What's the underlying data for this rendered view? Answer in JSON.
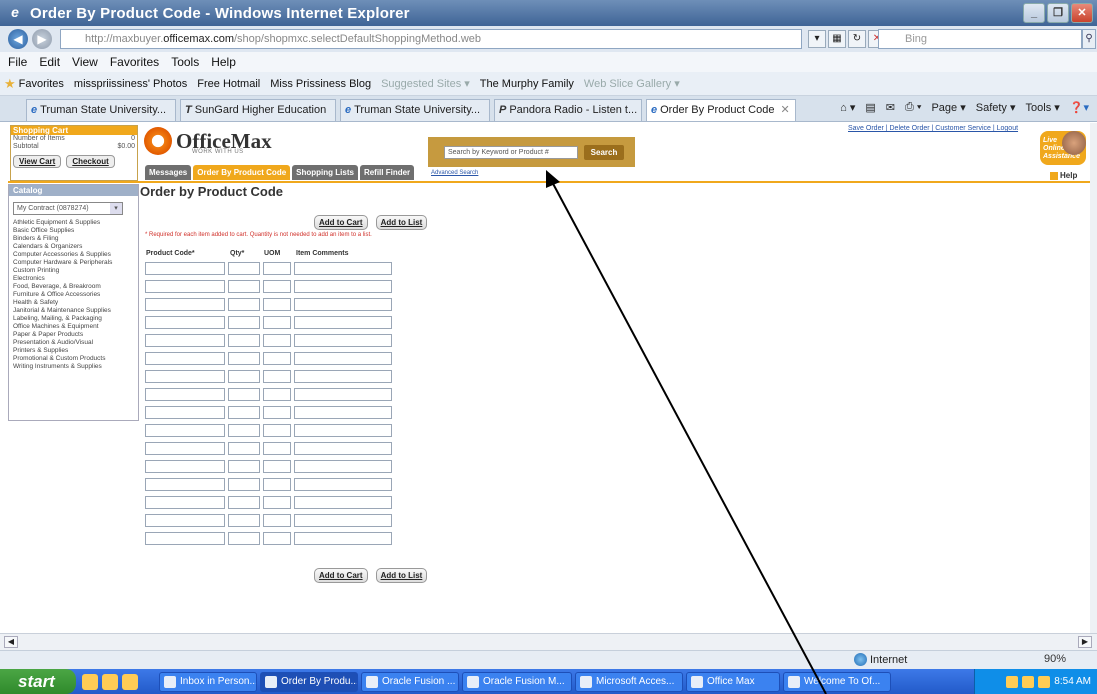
{
  "window": {
    "title": "Order By Product Code - Windows Internet Explorer",
    "minimize": "_",
    "maximize": "❐",
    "close": "✕"
  },
  "address": {
    "url_prefix": "http://maxbuyer.",
    "url_host": "officemax.com",
    "url_path": "/shop/shopmxc.selectDefaultShoppingMethod.web",
    "search_placeholder": "Bing"
  },
  "menu": [
    "File",
    "Edit",
    "View",
    "Favorites",
    "Tools",
    "Help"
  ],
  "favorites": [
    {
      "label": "Favorites",
      "dim": false
    },
    {
      "label": "misspriissiness' Photos",
      "dim": false
    },
    {
      "label": "Free Hotmail",
      "dim": false
    },
    {
      "label": "Miss Prissiness Blog",
      "dim": false
    },
    {
      "label": "Suggested Sites ▾",
      "dim": true
    },
    {
      "label": "The Murphy Family",
      "dim": false
    },
    {
      "label": "Web Slice Gallery ▾",
      "dim": true
    }
  ],
  "tabs": [
    {
      "label": "Truman State University..."
    },
    {
      "label": "SunGard Higher Education"
    },
    {
      "label": "Truman State University..."
    },
    {
      "label": "Pandora Radio - Listen t..."
    },
    {
      "label": "Order By Product Code"
    }
  ],
  "commands": [
    "Page ▾",
    "Safety ▾",
    "Tools ▾"
  ],
  "cart": {
    "heading": "Shopping Cart",
    "items_label": "Number of Items",
    "items_value": "0",
    "subtotal_label": "Subtotal",
    "subtotal_value": "$0.00",
    "view_cart": "View Cart",
    "checkout": "Checkout"
  },
  "brand": {
    "name": "OfficeMax",
    "tagline": "WORK WITH US"
  },
  "site_tabs": [
    {
      "label": "Messages",
      "active": false
    },
    {
      "label": "Order By Product Code",
      "active": true
    },
    {
      "label": "Shopping Lists",
      "active": false
    },
    {
      "label": "Refill Finder",
      "active": false
    }
  ],
  "site_search": {
    "placeholder": "Search by Keyword or Product #",
    "button": "Search",
    "advanced": "Advanced Search"
  },
  "top_links": "Save Order | Delete Order | Customer Service | Logout",
  "live_help": {
    "label": "Live Online Assistance",
    "help": "Help"
  },
  "catalog": {
    "heading": "Catalog",
    "contract": "My Contract (0878274)",
    "items": [
      "Athletic Equipment & Supplies",
      "Basic Office Supplies",
      "Binders & Filing",
      "Calendars & Organizers",
      "Computer Accessories & Supplies",
      "Computer Hardware & Peripherals",
      "Custom Printing",
      "Electronics",
      "Food, Beverage, & Breakroom",
      "Furniture & Office Accessories",
      "Health & Safety",
      "Janitorial & Maintenance Supplies",
      "Labeling, Mailing, & Packaging",
      "Office Machines & Equipment",
      "Paper & Paper Products",
      "Presentation & Audio/Visual",
      "Printers & Supplies",
      "Promotional & Custom Products",
      "Writing Instruments & Supplies"
    ]
  },
  "order": {
    "title": "Order by Product Code",
    "add_to_cart": "Add to Cart",
    "add_to_list": "Add to List",
    "note": "* Required for each item added to cart. Quantity is not needed to add an item to a list.",
    "col_code": "Product Code*",
    "col_qty": "Qty*",
    "col_uom": "UOM",
    "col_comments": "Item Comments",
    "row_count": 16
  },
  "status": {
    "zone": "Internet",
    "zoom": "90%"
  },
  "taskbar": {
    "start": "start",
    "buttons": [
      {
        "label": "Inbox in Person...",
        "active": false
      },
      {
        "label": "Order By Produ...",
        "active": true
      },
      {
        "label": "Oracle Fusion ...",
        "active": false
      },
      {
        "label": "Oracle Fusion M...",
        "active": false
      },
      {
        "label": "Microsoft Acces...",
        "active": false
      },
      {
        "label": "Office Max",
        "active": false
      },
      {
        "label": "Welcome To Of...",
        "active": false
      }
    ],
    "clock": "8:54 AM"
  }
}
